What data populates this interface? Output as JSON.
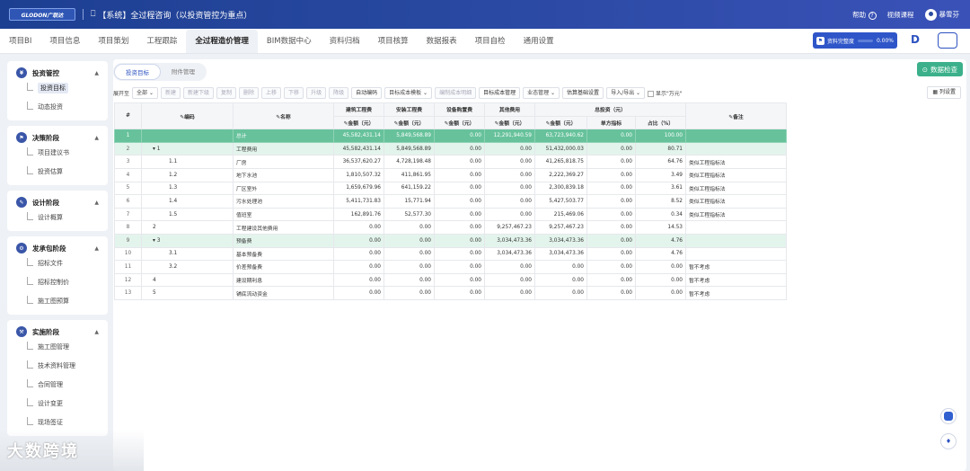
{
  "header": {
    "logo": "GLODON广联达",
    "title": "【系统】全过程咨询（以投资管控为重点）",
    "help": "帮助",
    "help_icon": "?",
    "video": "视频课程",
    "user": "暴雪芬"
  },
  "tabs": [
    "项目BI",
    "项目信息",
    "项目策划",
    "工程跟踪",
    "全过程造价管理",
    "BIM数据中心",
    "资料归档",
    "项目核算",
    "数据报表",
    "项目自检",
    "通用设置"
  ],
  "progress": {
    "label": "资料完整度",
    "value": "0.00%"
  },
  "sidebar": [
    {
      "title": "投资管控",
      "items": [
        "投资目标",
        "动态投资"
      ]
    },
    {
      "title": "决策阶段",
      "items": [
        "项目建议书",
        "投资估算"
      ]
    },
    {
      "title": "设计阶段",
      "items": [
        "设计概算"
      ]
    },
    {
      "title": "发承包阶段",
      "items": [
        "招标文件",
        "招标控制价",
        "施工图预算"
      ]
    },
    {
      "title": "实施阶段",
      "items": [
        "施工图管理",
        "技术资料管理",
        "合同管理",
        "设计变更",
        "现场签证"
      ]
    }
  ],
  "subtabs": [
    "投资目标",
    "附件管理"
  ],
  "check_button": "数据检查",
  "toolbar": {
    "expand_label": "展开至",
    "expand_value": "全部",
    "buttons": [
      "新建",
      "新建下级",
      "复制",
      "删除",
      "上移",
      "下移",
      "升级",
      "降级",
      "自动编码",
      "目标成本模板",
      "编制成本明细",
      "目标成本管理",
      "业态管理",
      "估算基础设置",
      "导入/导出"
    ],
    "wan_label": "显示\"万元\"",
    "col_settings": "列设置"
  },
  "table": {
    "h_idx": "#",
    "h_code": "编码",
    "h_name": "名称",
    "h_build": "建筑工程费",
    "h_install": "安装工程费",
    "h_equip": "设备购置费",
    "h_other": "其他费用",
    "h_total": "总投资（元）",
    "h_note": "备注",
    "h_amt": "金额（元）",
    "h_unit": "单方指标",
    "h_pct": "占比（%）",
    "rows": [
      {
        "i": "1",
        "code": "",
        "name": "总计",
        "b": "45,582,431.14",
        "ins": "5,849,568.89",
        "e": "0.00",
        "o": "12,291,940.59",
        "t": "63,723,940.62",
        "u": "0.00",
        "p": "100.00",
        "note": "",
        "kind": "total"
      },
      {
        "i": "2",
        "code": "▾ 1",
        "name": "工程费用",
        "b": "45,582,431.14",
        "ins": "5,849,568.89",
        "e": "0.00",
        "o": "0.00",
        "t": "51,432,000.03",
        "u": "0.00",
        "p": "80.71",
        "note": "",
        "kind": "grp"
      },
      {
        "i": "3",
        "code": "1.1",
        "name": "厂房",
        "b": "36,537,620.27",
        "ins": "4,728,198.48",
        "e": "0.00",
        "o": "0.00",
        "t": "41,265,818.75",
        "u": "0.00",
        "p": "64.76",
        "note": "类似工程指标法",
        "kind": ""
      },
      {
        "i": "4",
        "code": "1.2",
        "name": "地下水池",
        "b": "1,810,507.32",
        "ins": "411,861.95",
        "e": "0.00",
        "o": "0.00",
        "t": "2,222,369.27",
        "u": "0.00",
        "p": "3.49",
        "note": "类似工程指标法",
        "kind": ""
      },
      {
        "i": "5",
        "code": "1.3",
        "name": "厂区室外",
        "b": "1,659,679.96",
        "ins": "641,159.22",
        "e": "0.00",
        "o": "0.00",
        "t": "2,300,839.18",
        "u": "0.00",
        "p": "3.61",
        "note": "类似工程指标法",
        "kind": ""
      },
      {
        "i": "6",
        "code": "1.4",
        "name": "污水处理池",
        "b": "5,411,731.83",
        "ins": "15,771.94",
        "e": "0.00",
        "o": "0.00",
        "t": "5,427,503.77",
        "u": "0.00",
        "p": "8.52",
        "note": "类似工程指标法",
        "kind": ""
      },
      {
        "i": "7",
        "code": "1.5",
        "name": "值班室",
        "b": "162,891.76",
        "ins": "52,577.30",
        "e": "0.00",
        "o": "0.00",
        "t": "215,469.06",
        "u": "0.00",
        "p": "0.34",
        "note": "类似工程指标法",
        "kind": ""
      },
      {
        "i": "8",
        "code": "2",
        "name": "工程建设其他费用",
        "b": "0.00",
        "ins": "0.00",
        "e": "0.00",
        "o": "9,257,467.23",
        "t": "9,257,467.23",
        "u": "0.00",
        "p": "14.53",
        "note": "",
        "kind": ""
      },
      {
        "i": "9",
        "code": "▾ 3",
        "name": "预备费",
        "b": "0.00",
        "ins": "0.00",
        "e": "0.00",
        "o": "3,034,473.36",
        "t": "3,034,473.36",
        "u": "0.00",
        "p": "4.76",
        "note": "",
        "kind": "grp"
      },
      {
        "i": "10",
        "code": "3.1",
        "name": "基本预备费",
        "b": "0.00",
        "ins": "0.00",
        "e": "0.00",
        "o": "3,034,473.36",
        "t": "3,034,473.36",
        "u": "0.00",
        "p": "4.76",
        "note": "",
        "kind": ""
      },
      {
        "i": "11",
        "code": "3.2",
        "name": "价差预备费",
        "b": "0.00",
        "ins": "0.00",
        "e": "0.00",
        "o": "0.00",
        "t": "0.00",
        "u": "0.00",
        "p": "0.00",
        "note": "暂不考虑",
        "kind": ""
      },
      {
        "i": "12",
        "code": "4",
        "name": "建设期利息",
        "b": "0.00",
        "ins": "0.00",
        "e": "0.00",
        "o": "0.00",
        "t": "0.00",
        "u": "0.00",
        "p": "0.00",
        "note": "暂不考虑",
        "kind": ""
      },
      {
        "i": "13",
        "code": "5",
        "name": "铺底流动资金",
        "b": "0.00",
        "ins": "0.00",
        "e": "0.00",
        "o": "0.00",
        "t": "0.00",
        "u": "0.00",
        "p": "0.00",
        "note": "暂不考虑",
        "kind": ""
      }
    ]
  },
  "watermark": "大数跨境"
}
